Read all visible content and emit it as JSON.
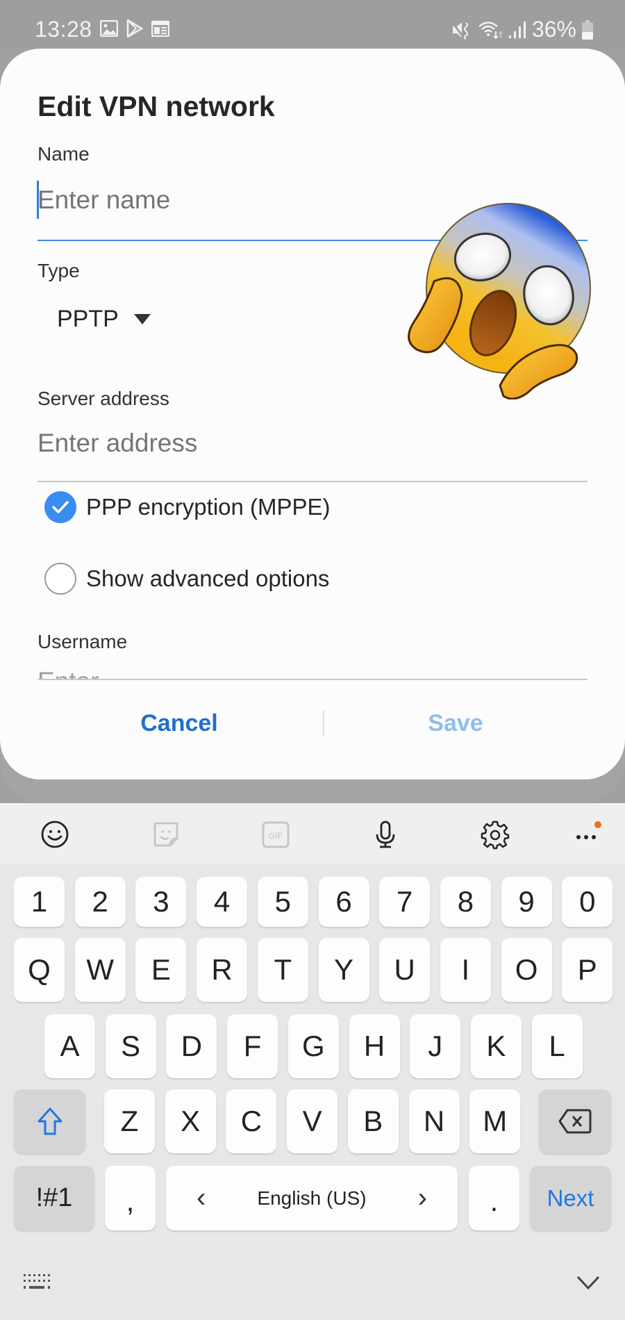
{
  "status_bar": {
    "time": "13:28",
    "left_icons": [
      "gallery-icon",
      "play-store-icon",
      "calendar-news-icon"
    ],
    "right_icons": [
      "mute-vibrate-icon",
      "wifi-icon",
      "signal-icon"
    ],
    "battery_percent": "36%"
  },
  "dialog": {
    "title": "Edit VPN network",
    "name_label": "Name",
    "name_placeholder": "Enter name",
    "name_value": "",
    "type_label": "Type",
    "type_value": "PPTP",
    "server_label": "Server address",
    "server_placeholder": "Enter address",
    "server_value": "",
    "ppp_encryption": {
      "label": "PPP encryption (MPPE)",
      "checked": true
    },
    "advanced_options": {
      "label": "Show advanced options",
      "checked": false
    },
    "username_label": "Username",
    "username_placeholder_partial": "Enter",
    "cancel_label": "Cancel",
    "save_label": "Save"
  },
  "overlay": {
    "emoji": "face-screaming-in-fear"
  },
  "keyboard": {
    "toolbar": [
      "emoji-icon",
      "sticker-icon",
      "gif-icon",
      "microphone-icon",
      "settings-icon",
      "more-icon"
    ],
    "toolbar_gif_text": "GIF",
    "number_row": [
      "1",
      "2",
      "3",
      "4",
      "5",
      "6",
      "7",
      "8",
      "9",
      "0"
    ],
    "row1": [
      "Q",
      "W",
      "E",
      "R",
      "T",
      "Y",
      "U",
      "I",
      "O",
      "P"
    ],
    "row2": [
      "A",
      "S",
      "D",
      "F",
      "G",
      "H",
      "J",
      "K",
      "L"
    ],
    "row3": [
      "Z",
      "X",
      "C",
      "V",
      "B",
      "N",
      "M"
    ],
    "symbols_label": "!#1",
    "comma": ",",
    "period": ".",
    "space_label": "English (US)",
    "space_left": "‹",
    "space_right": "›",
    "action_label": "Next"
  },
  "colors": {
    "accent": "#1e6fd0",
    "checkbox": "#3b8cf0",
    "save_disabled": "#8fbdea",
    "notification_dot": "#f26b1d"
  }
}
